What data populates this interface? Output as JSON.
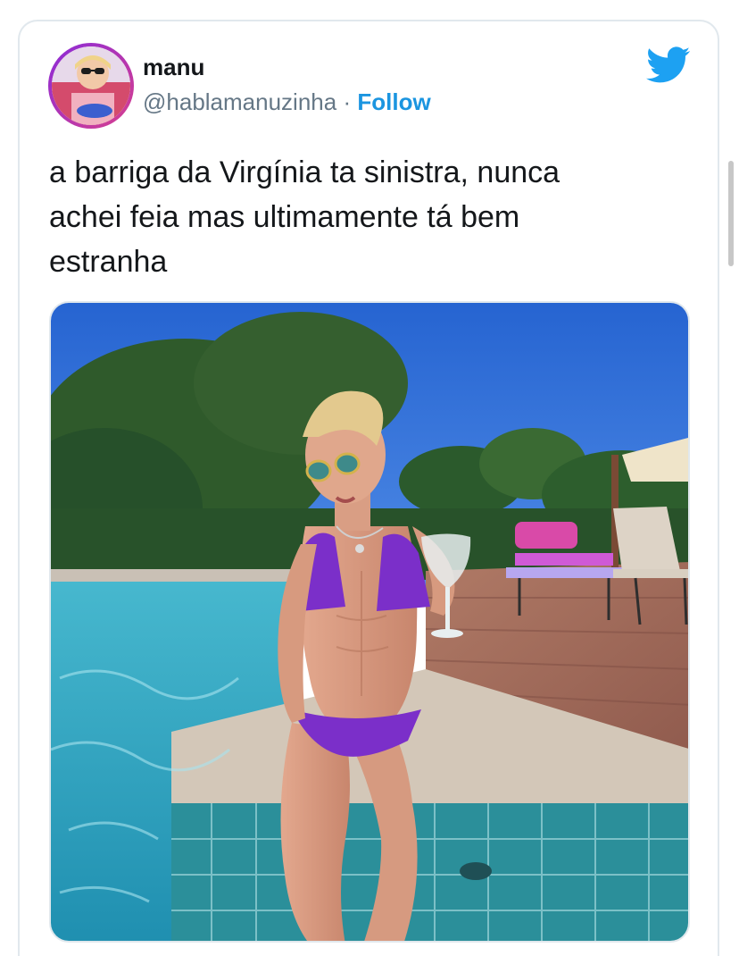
{
  "tweet": {
    "author_name": "manu",
    "handle": "@hablamanuzinha",
    "separator": "·",
    "follow_label": "Follow",
    "text_lines": [
      "a barriga da Virgínia ta sinistra, nunca",
      "achei feia mas ultimamente tá bem",
      "estranha"
    ],
    "icon": "twitter-bird-icon",
    "media_description_icon": "photo"
  },
  "colors": {
    "accent": "#1b95e0",
    "text": "#14171a",
    "muted": "#657786",
    "border": "#e1e8ed",
    "sky": "#2f6fd6",
    "pool": "#2aa8c4",
    "deck": "#a0685a",
    "bikini": "#7b2fc9"
  }
}
